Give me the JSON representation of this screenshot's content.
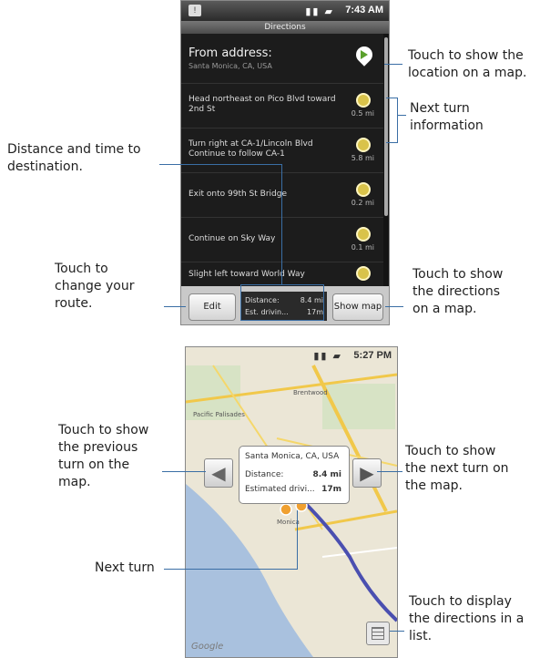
{
  "phone1": {
    "status_time": "7:43 AM",
    "title": "Directions",
    "from_label": "From address:",
    "from_value": "Santa Monica, CA, USA",
    "steps": [
      {
        "text": "Head northeast on Pico Blvd toward 2nd St",
        "distance": "0.5 mi"
      },
      {
        "text": "Turn right at CA-1/Lincoln Blvd Continue to follow CA-1",
        "distance": "5.8 mi"
      },
      {
        "text": "Exit onto 99th St Bridge",
        "distance": "0.2 mi"
      },
      {
        "text": "Continue on Sky Way",
        "distance": "0.1 mi"
      },
      {
        "text": "Slight left toward World Way",
        "distance": ""
      }
    ],
    "edit_label": "Edit",
    "show_map_label": "Show map",
    "summary_distance_label": "Distance:",
    "summary_distance_value": "8.4 mi",
    "summary_time_label": "Est. drivin...",
    "summary_time_value": "17m"
  },
  "phone2": {
    "status_time": "5:27 PM",
    "info_location": "Santa Monica, CA, USA",
    "info_distance_label": "Distance:",
    "info_distance_value": "8.4 mi",
    "info_time_label": "Estimated drivi...",
    "info_time_value": "17m",
    "map_labels": [
      "Pacific Palisades",
      "Brentwood",
      "Monica"
    ],
    "google_logo": "Google"
  },
  "callouts": {
    "show_location": "Touch to show the location on a map.",
    "next_turn_info": "Next turn information",
    "distance_time": "Distance and time to destination.",
    "change_route": "Touch to change your route.",
    "show_directions_map": "Touch to show the directions on a map.",
    "previous_turn": "Touch to show the previous turn on the map.",
    "next_turn_map": "Touch to show the next turn on the map.",
    "next_turn": "Next turn",
    "display_list": "Touch to display the directions in a list."
  },
  "colors": {
    "callout_line": "#3a6ea5",
    "route": "#4a4fb0",
    "pin": "#d9c34a"
  }
}
